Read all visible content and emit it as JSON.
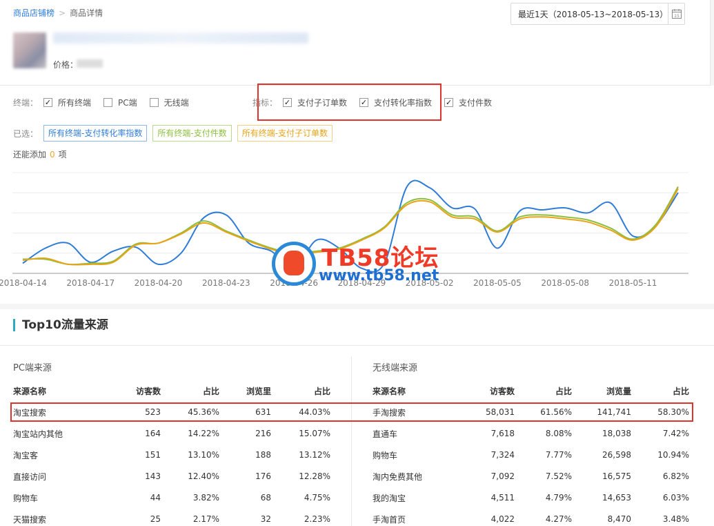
{
  "breadcrumb": {
    "shop_rank": "商品店铺榜",
    "separator": ">",
    "detail": "商品详情"
  },
  "date_picker": {
    "value": "最近1天（2018-05-13~2018-05-13）"
  },
  "product": {
    "price_label": "价格："
  },
  "filters": {
    "terminal_label": "终端：",
    "terminals": [
      {
        "label": "所有终端",
        "checked": true
      },
      {
        "label": "PC端",
        "checked": false
      },
      {
        "label": "无线端",
        "checked": false
      }
    ],
    "metric_label": "指标：",
    "metrics": [
      {
        "label": "支付子订单数",
        "checked": true
      },
      {
        "label": "支付转化率指数",
        "checked": true
      },
      {
        "label": "支付件数",
        "checked": true
      }
    ],
    "selected_label": "已选：",
    "selected_tags": [
      {
        "label": "所有终端-支付转化率指数",
        "color": "#2f7cd8"
      },
      {
        "label": "所有终端-支付件数",
        "color": "#8cbf3f"
      },
      {
        "label": "所有终端-支付子订单数",
        "color": "#e8a317"
      }
    ],
    "add_more_prefix": "还能添加",
    "add_more_count": "0",
    "add_more_suffix": "项"
  },
  "chart_data": {
    "type": "line",
    "x_tick_labels": [
      "2018-04-14",
      "2018-04-17",
      "2018-04-20",
      "2018-04-23",
      "2018-04-26",
      "2018-04-29",
      "2018-05-02",
      "2018-05-05",
      "2018-05-08",
      "2018-05-11"
    ],
    "x": [
      "2018-04-14",
      "2018-04-15",
      "2018-04-16",
      "2018-04-17",
      "2018-04-18",
      "2018-04-19",
      "2018-04-20",
      "2018-04-21",
      "2018-04-22",
      "2018-04-23",
      "2018-04-24",
      "2018-04-25",
      "2018-04-26",
      "2018-04-27",
      "2018-04-28",
      "2018-04-29",
      "2018-04-30",
      "2018-05-01",
      "2018-05-02",
      "2018-05-03",
      "2018-05-04",
      "2018-05-05",
      "2018-05-06",
      "2018-05-07",
      "2018-05-08",
      "2018-05-09",
      "2018-05-10",
      "2018-05-11",
      "2018-05-12",
      "2018-05-13"
    ],
    "ylim": [
      0,
      100
    ],
    "grid": true,
    "series": [
      {
        "name": "所有终端-支付转化率指数",
        "color": "#2f7cd8",
        "values": [
          10,
          25,
          30,
          11,
          22,
          26,
          9,
          20,
          55,
          58,
          30,
          22,
          5,
          33,
          25,
          5,
          10,
          86,
          85,
          65,
          64,
          25,
          62,
          63,
          65,
          60,
          70,
          37,
          47,
          80
        ]
      },
      {
        "name": "所有终端-支付件数",
        "color": "#8cbf3f",
        "values": [
          14,
          14,
          9,
          10,
          12,
          29,
          30,
          40,
          52,
          42,
          33,
          25,
          20,
          22,
          25,
          34,
          46,
          70,
          73,
          58,
          56,
          42,
          56,
          58,
          56,
          53,
          45,
          34,
          48,
          86
        ]
      },
      {
        "name": "所有终端-支付子订单数",
        "color": "#e8a317",
        "values": [
          13,
          15,
          9,
          9,
          11,
          28,
          30,
          39,
          50,
          41,
          32,
          24,
          18,
          21,
          24,
          33,
          45,
          68,
          71,
          56,
          54,
          41,
          54,
          56,
          54,
          51,
          43,
          33,
          46,
          84
        ]
      }
    ]
  },
  "watermark": {
    "title": "TB58论坛",
    "url": "www.tb58.net"
  },
  "top10": {
    "title": "Top10流量来源",
    "pc": {
      "title": "PC端来源",
      "headers": [
        "来源名称",
        "访客数",
        "占比",
        "浏览里",
        "占比"
      ],
      "rows": [
        [
          "淘宝搜索",
          "523",
          "45.36%",
          "631",
          "44.03%"
        ],
        [
          "淘宝站内其他",
          "164",
          "14.22%",
          "216",
          "15.07%"
        ],
        [
          "淘宝客",
          "151",
          "13.10%",
          "188",
          "13.12%"
        ],
        [
          "直接访问",
          "143",
          "12.40%",
          "176",
          "12.28%"
        ],
        [
          "购物车",
          "44",
          "3.82%",
          "68",
          "4.75%"
        ],
        [
          "天猫搜索",
          "25",
          "2.17%",
          "32",
          "2.23%"
        ]
      ]
    },
    "mobile": {
      "title": "无线端来源",
      "headers": [
        "来源名称",
        "访客数",
        "占比",
        "浏览量",
        "占比"
      ],
      "rows": [
        [
          "手淘搜索",
          "58,031",
          "61.56%",
          "141,741",
          "58.30%"
        ],
        [
          "直通车",
          "7,618",
          "8.08%",
          "18,038",
          "7.42%"
        ],
        [
          "购物车",
          "7,324",
          "7.77%",
          "26,598",
          "10.94%"
        ],
        [
          "淘内免费其他",
          "7,092",
          "7.52%",
          "16,575",
          "6.82%"
        ],
        [
          "我的淘宝",
          "4,511",
          "4.79%",
          "14,653",
          "6.03%"
        ],
        [
          "手淘首页",
          "4,022",
          "4.27%",
          "8,470",
          "3.48%"
        ]
      ]
    }
  }
}
